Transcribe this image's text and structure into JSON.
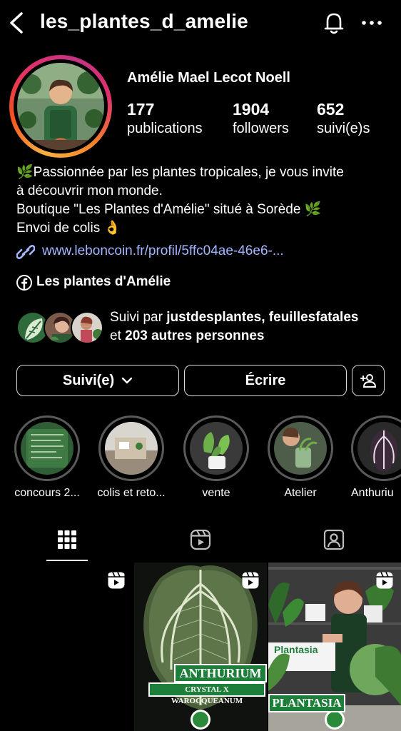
{
  "header": {
    "username": "les_plantes_d_amelie",
    "back_icon": "chevron-left-icon",
    "notification_icon": "bell-icon",
    "more_icon": "more-horizontal-icon"
  },
  "profile": {
    "full_name": "Amélie Mael Lecot Noell",
    "stats": [
      {
        "value": "177",
        "label": "publications"
      },
      {
        "value": "1904",
        "label": "followers"
      },
      {
        "value": "652",
        "label": "suivi(e)s"
      }
    ],
    "bio_lines": [
      "🌿Passionnée par les plantes tropicales, je vous invite",
      "à découvrir mon monde.",
      "Boutique \"Les Plantes d'Amélie\" situé à Sorède 🌿",
      "Envoi de colis 👌"
    ],
    "link": "www.leboncoin.fr/profil/5ffc04ae-46e6-...",
    "facebook_page": "Les plantes d'Amélie",
    "followed_by": {
      "prefix": "Suivi par ",
      "users": "justdesplantes, feuillesfatales",
      "connector": "et ",
      "others": "203 autres personnes"
    }
  },
  "actions": {
    "following_label": "Suivi(e)",
    "message_label": "Écrire"
  },
  "highlights": [
    {
      "label": "concours 2..."
    },
    {
      "label": "colis et reto..."
    },
    {
      "label": "vente"
    },
    {
      "label": "Atelier"
    },
    {
      "label": "Anthuriu"
    }
  ],
  "tabs": [
    "grid-icon",
    "reels-icon",
    "tagged-icon"
  ],
  "posts": [
    {
      "title": "",
      "subtitle": ""
    },
    {
      "title": "ANTHURIUM",
      "subtitle": "CRYSTAL X WAROCQUEANUM"
    },
    {
      "title": "PLANTASIA",
      "subtitle": "Plantasia"
    }
  ],
  "colors": {
    "background": "#000000",
    "link": "#a4b6ff",
    "label_green": "#1e7f3a"
  }
}
